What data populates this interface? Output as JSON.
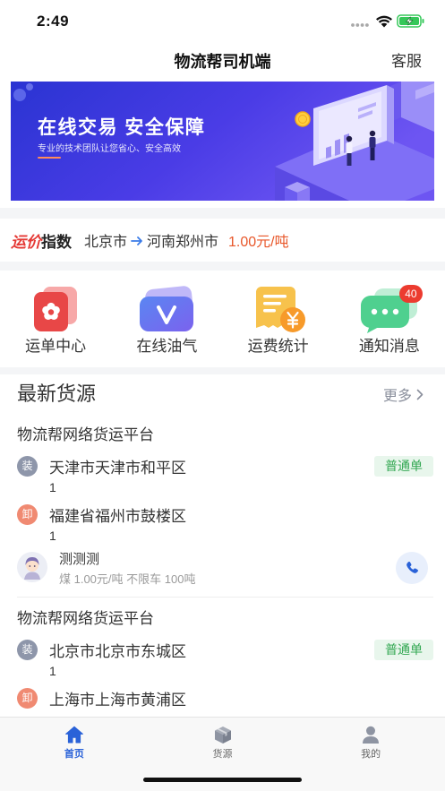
{
  "status_bar": {
    "time": "2:49"
  },
  "header": {
    "title": "物流帮司机端",
    "service_label": "客服"
  },
  "banner": {
    "headline": "在线交易 安全保障",
    "subline": "专业的技术团队让您省心、安全高效"
  },
  "freight_index": {
    "label_red": "运价",
    "label_black": "指数",
    "from": "北京市",
    "to": "河南郑州市",
    "price": "1.00元/吨"
  },
  "quick_menu": [
    {
      "label": "运单中心",
      "icon": "waybill-icon"
    },
    {
      "label": "在线油气",
      "icon": "fuel-icon"
    },
    {
      "label": "运费统计",
      "icon": "freight-stats-icon"
    },
    {
      "label": "通知消息",
      "icon": "notification-icon",
      "badge": "40"
    }
  ],
  "section": {
    "title": "最新货源",
    "more": "更多"
  },
  "cargo_list": [
    {
      "company": "物流帮网络货运平台",
      "load_tag": "装",
      "load_address": "天津市天津市和平区",
      "load_sub": "1",
      "unload_tag": "卸",
      "unload_address": "福建省福州市鼓楼区",
      "unload_sub": "1",
      "order_type": "普通单",
      "contact": "测测测",
      "detail": "煤 1.00元/吨 不限车 100吨"
    },
    {
      "company": "物流帮网络货运平台",
      "load_tag": "装",
      "load_address": "北京市北京市东城区",
      "load_sub": "1",
      "unload_tag": "卸",
      "unload_address": "上海市上海市黄浦区",
      "order_type": "普通单"
    }
  ],
  "tab_bar": [
    {
      "label": "首页",
      "icon": "home-icon",
      "active": true
    },
    {
      "label": "货源",
      "icon": "cargo-box-icon",
      "active": false
    },
    {
      "label": "我的",
      "icon": "profile-icon",
      "active": false
    }
  ],
  "colors": {
    "primary": "#2a62d8",
    "price": "#e8572a",
    "index_red": "#e53935",
    "tag_load": "#8e96aa",
    "tag_unload": "#f08a72",
    "order_badge_bg": "#e8f6ec",
    "order_badge_text": "#34a853",
    "badge": "#ec3b2f",
    "page_gap": "#f4f5f7"
  }
}
